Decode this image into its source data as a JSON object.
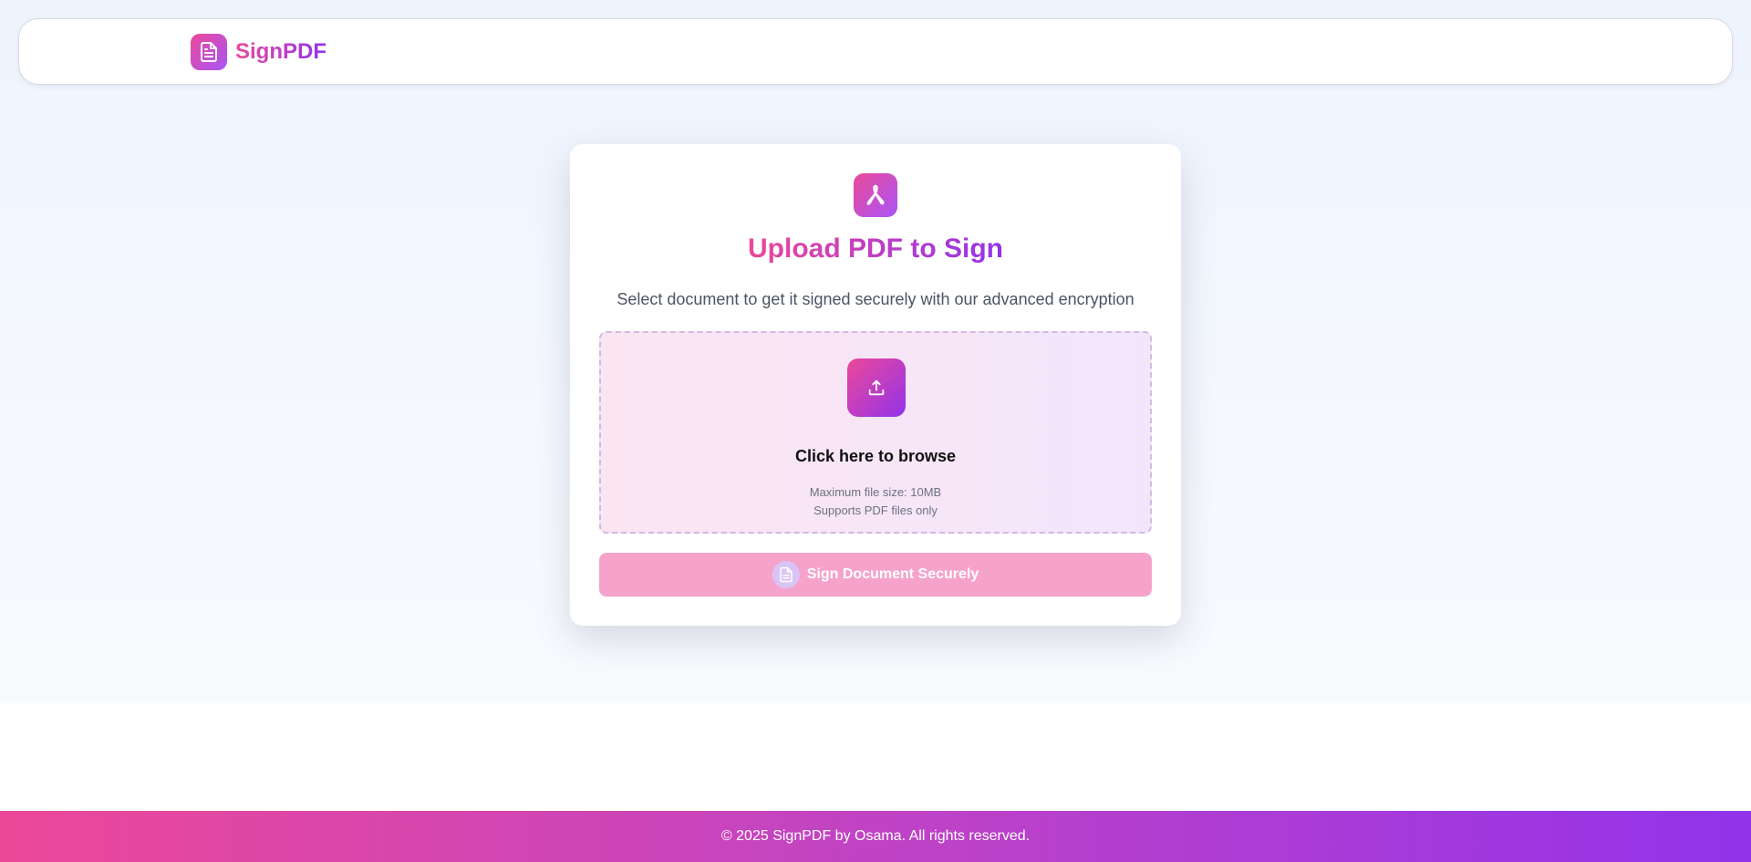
{
  "header": {
    "brand_name": "SignPDF",
    "logo_icon": "document-icon"
  },
  "upload_card": {
    "icon": "pdf-icon",
    "title": "Upload PDF to Sign",
    "subtitle": "Select document to get it signed securely with our advanced encryption",
    "dropzone": {
      "icon": "upload-icon",
      "browse_label": "Click here to browse",
      "max_size_hint": "Maximum file size: 10MB",
      "format_hint": "Supports PDF files only"
    },
    "sign_button": {
      "label": "Sign Document Securely",
      "icon": "document-icon",
      "disabled": true
    }
  },
  "footer": {
    "copyright": "© 2025 SignPDF by Osama. All rights reserved."
  },
  "colors": {
    "accent_start": "#ec4899",
    "accent_end": "#9333ea",
    "disabled_button": "#f5a3cb"
  }
}
